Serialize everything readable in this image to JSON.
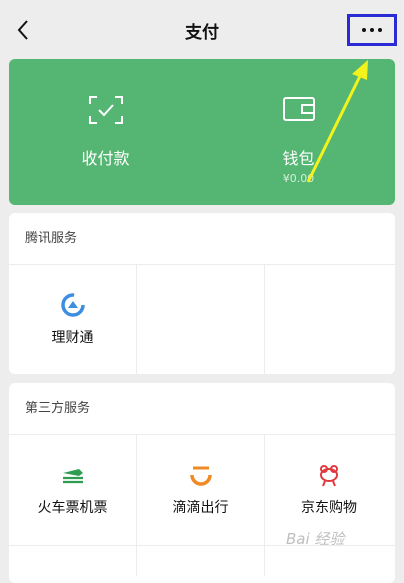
{
  "nav": {
    "title": "支付"
  },
  "actions": [
    {
      "label": "收付款",
      "sub": ""
    },
    {
      "label": "钱包",
      "sub": "¥0.00"
    }
  ],
  "tencent": {
    "title": "腾讯服务",
    "items": [
      {
        "label": "理财通",
        "icon": "licaitong-icon"
      }
    ]
  },
  "third_party": {
    "title": "第三方服务",
    "items": [
      {
        "label": "火车票机票",
        "icon": "train-ticket-icon"
      },
      {
        "label": "滴滴出行",
        "icon": "didi-icon"
      },
      {
        "label": "京东购物",
        "icon": "jd-shopping-icon"
      }
    ]
  },
  "colors": {
    "accent": "#55b572",
    "highlight_box": "#2b2bd6",
    "arrow": "#f2f21c"
  },
  "watermark": "Bai 经验"
}
